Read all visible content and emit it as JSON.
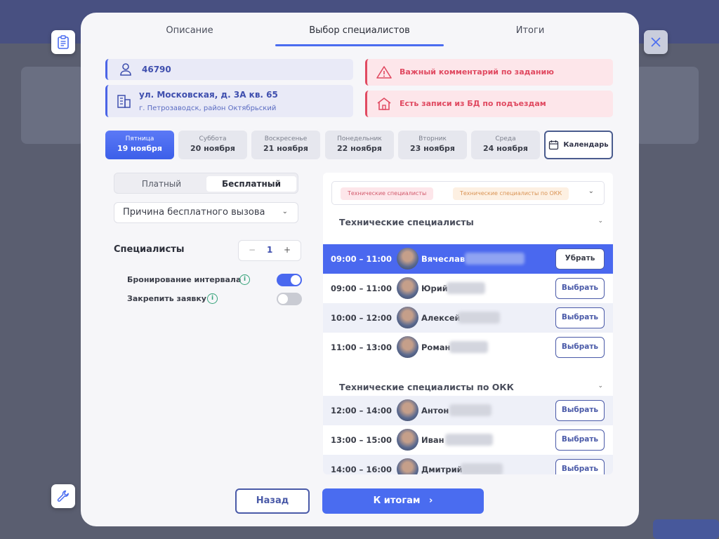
{
  "tabs": [
    {
      "label": "Описание"
    },
    {
      "label": "Выбор специалистов"
    },
    {
      "label": "Итоги"
    }
  ],
  "info": {
    "order_id": "46790",
    "address": "ул. Московская, д. 3А кв. 65",
    "city": "г. Петрозаводск, район Октябрьский"
  },
  "alerts": {
    "important_comment": "Важный комментарий по заданию",
    "db_entries": "Есть записи из БД по подъездам"
  },
  "days": [
    {
      "weekday": "Пятница",
      "date": "19 ноября",
      "active": true
    },
    {
      "weekday": "Суббота",
      "date": "20 ноября"
    },
    {
      "weekday": "Воскресенье",
      "date": "21 ноября"
    },
    {
      "weekday": "Понедельник",
      "date": "22 ноября"
    },
    {
      "weekday": "Вторник",
      "date": "23 ноября"
    },
    {
      "weekday": "Среда",
      "date": "24 ноября"
    }
  ],
  "calendar_label": "Календарь",
  "payment": {
    "paid": "Платный",
    "free": "Бесплатный",
    "selected": "free"
  },
  "reason_dropdown": "Причина бесплатного вызова",
  "specialists": {
    "label": "Специалисты",
    "minus": "−",
    "count": "1",
    "plus": "+"
  },
  "toggles": [
    {
      "label": "Бронирование интервала",
      "on": true
    },
    {
      "label": "Закрепить заявку",
      "on": false
    }
  ],
  "filter_chips": [
    "Технические специалисты",
    "Технические специалисты по ОКК"
  ],
  "groups": [
    {
      "title": "Технические специалисты",
      "rows": [
        {
          "time": "09:00 – 11:00",
          "name": "Вячеслав",
          "action": "Убрать",
          "selected": true
        },
        {
          "time": "09:00 – 11:00",
          "name": "Юрий",
          "action": "Выбрать"
        },
        {
          "time": "10:00 – 12:00",
          "name": "Алексей",
          "action": "Выбрать"
        },
        {
          "time": "11:00 – 13:00",
          "name": "Роман",
          "action": "Выбрать"
        }
      ]
    },
    {
      "title": "Технические специалисты по ОКК",
      "rows": [
        {
          "time": "12:00 – 14:00",
          "name": "Антон",
          "action": "Выбрать"
        },
        {
          "time": "13:00 – 15:00",
          "name": "Иван",
          "action": "Выбрать"
        },
        {
          "time": "14:00 – 16:00",
          "name": "Дмитрий",
          "action": "Выбрать"
        }
      ]
    }
  ],
  "footer": {
    "back": "Назад",
    "next": "К итогам",
    "next_arrow": "›"
  },
  "colors": {
    "accent": "#4a6cf0",
    "alert_red": "#e04a61",
    "info_blue": "#3f4fae",
    "toggle_on": "#4a68ef"
  }
}
